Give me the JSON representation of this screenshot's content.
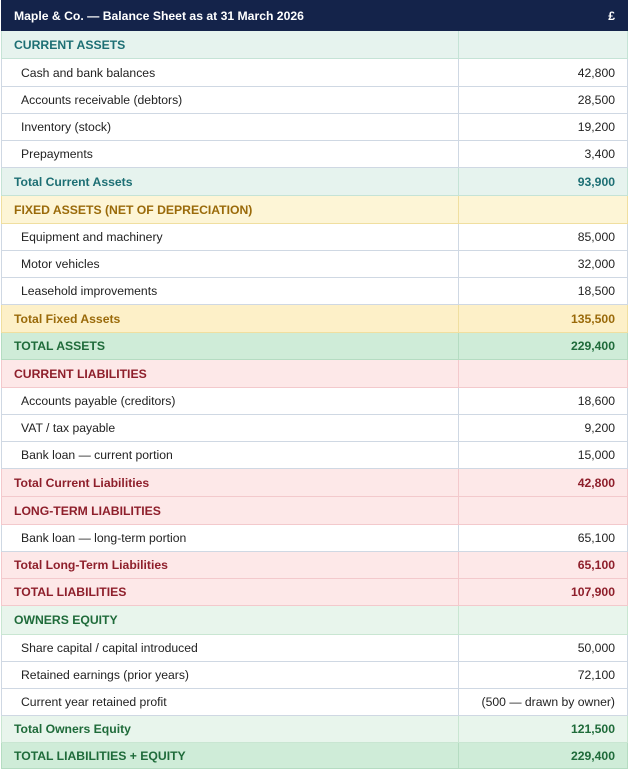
{
  "title": {
    "label": "Maple & Co. — Balance Sheet as at 31 March 2026",
    "currency": "£"
  },
  "rows": [
    {
      "type": "sec",
      "theme": "blue",
      "label": "CURRENT ASSETS",
      "amount": ""
    },
    {
      "type": "item",
      "theme": "",
      "label": "Cash and bank balances",
      "amount": "42,800"
    },
    {
      "type": "item",
      "theme": "",
      "label": "Accounts receivable (debtors)",
      "amount": "28,500"
    },
    {
      "type": "item",
      "theme": "",
      "label": "Inventory (stock)",
      "amount": "19,200"
    },
    {
      "type": "item",
      "theme": "",
      "label": "Prepayments",
      "amount": "3,400"
    },
    {
      "type": "tot",
      "theme": "blue",
      "label": "Total Current Assets",
      "amount": "93,900"
    },
    {
      "type": "sec",
      "theme": "gold",
      "label": "FIXED ASSETS (NET OF DEPRECIATION)",
      "amount": ""
    },
    {
      "type": "item",
      "theme": "",
      "label": "Equipment and machinery",
      "amount": "85,000"
    },
    {
      "type": "item",
      "theme": "",
      "label": "Motor vehicles",
      "amount": "32,000"
    },
    {
      "type": "item",
      "theme": "",
      "label": "Leasehold improvements",
      "amount": "18,500"
    },
    {
      "type": "tot",
      "theme": "goldtot",
      "label": "Total Fixed Assets",
      "amount": "135,500"
    },
    {
      "type": "grand",
      "theme": "greenbig",
      "label": "TOTAL ASSETS",
      "amount": "229,400"
    },
    {
      "type": "sec",
      "theme": "red",
      "label": "CURRENT LIABILITIES",
      "amount": ""
    },
    {
      "type": "item",
      "theme": "",
      "label": "Accounts payable (creditors)",
      "amount": "18,600"
    },
    {
      "type": "item",
      "theme": "",
      "label": "VAT / tax payable",
      "amount": "9,200"
    },
    {
      "type": "item",
      "theme": "",
      "label": "Bank loan — current portion",
      "amount": "15,000"
    },
    {
      "type": "tot",
      "theme": "red",
      "label": "Total Current Liabilities",
      "amount": "42,800"
    },
    {
      "type": "sec",
      "theme": "red",
      "label": "LONG-TERM LIABILITIES",
      "amount": ""
    },
    {
      "type": "item",
      "theme": "",
      "label": "Bank loan — long-term portion",
      "amount": "65,100"
    },
    {
      "type": "tot",
      "theme": "red",
      "label": "Total Long-Term Liabilities",
      "amount": "65,100"
    },
    {
      "type": "grand",
      "theme": "red",
      "label": "TOTAL LIABILITIES",
      "amount": "107,900"
    },
    {
      "type": "sec",
      "theme": "green",
      "label": "OWNERS EQUITY",
      "amount": ""
    },
    {
      "type": "item",
      "theme": "",
      "label": "Share capital / capital introduced",
      "amount": "50,000"
    },
    {
      "type": "item",
      "theme": "",
      "label": "Retained earnings (prior years)",
      "amount": "72,100"
    },
    {
      "type": "item",
      "theme": "",
      "label": "Current year retained profit",
      "amount": "(500 — drawn by owner)"
    },
    {
      "type": "tot",
      "theme": "green",
      "label": "Total Owners Equity",
      "amount": "121,500"
    },
    {
      "type": "grand",
      "theme": "greenbig",
      "label": "TOTAL LIABILITIES + EQUITY",
      "amount": "229,400"
    }
  ]
}
